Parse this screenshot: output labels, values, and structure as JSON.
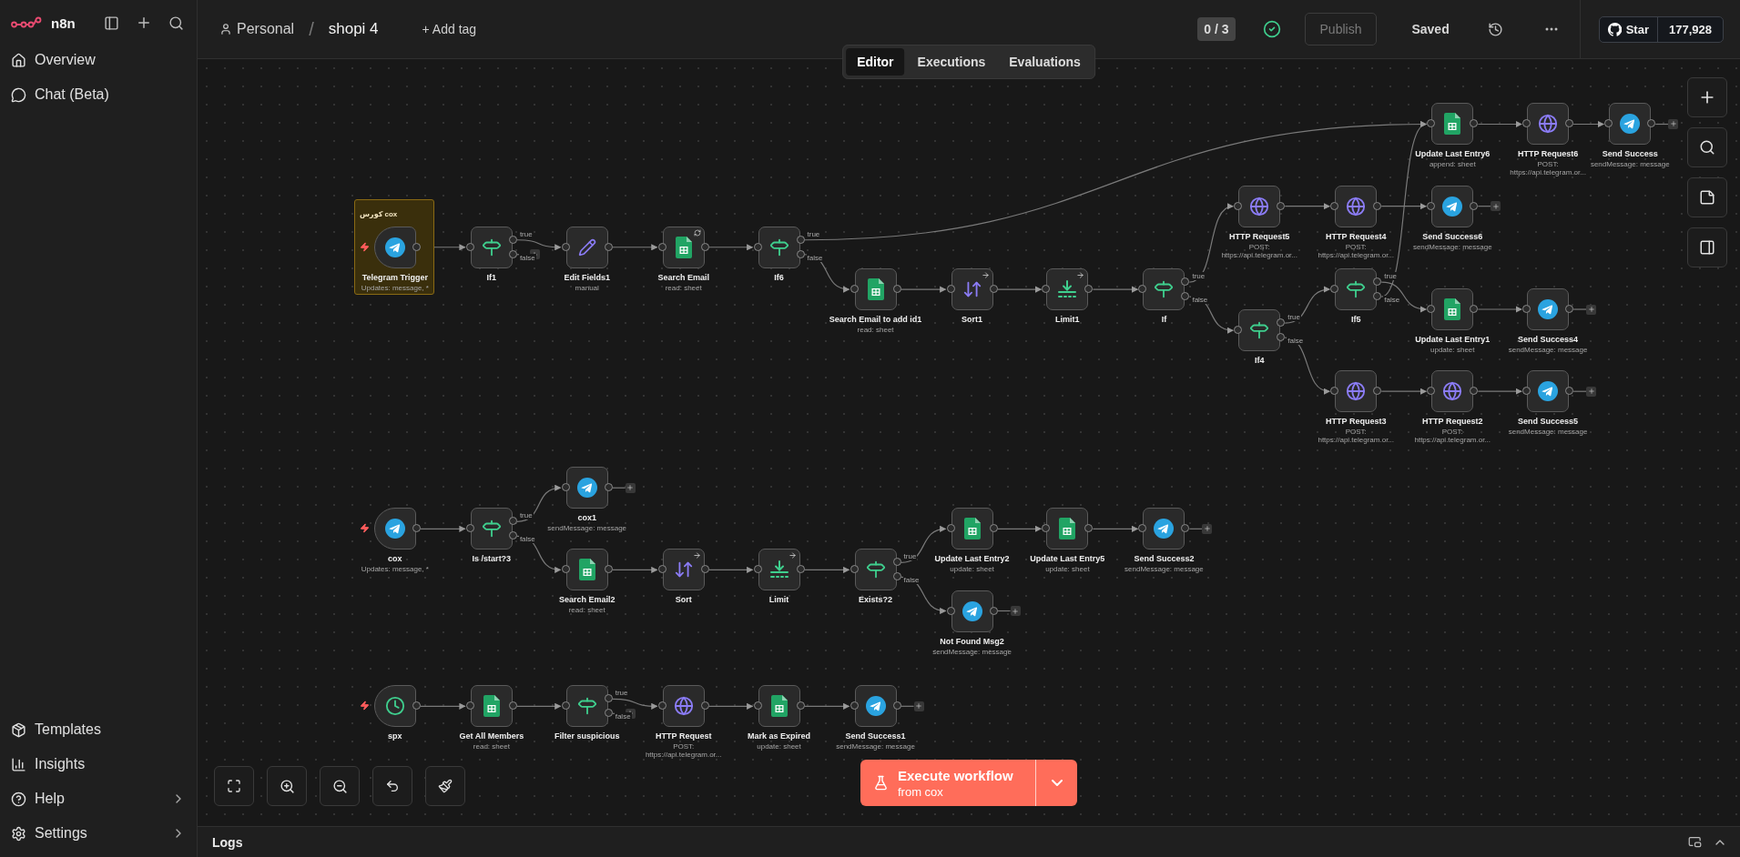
{
  "sidebar": {
    "brand": "n8n",
    "top_items": [
      {
        "label": "Overview",
        "has_submenu": false
      },
      {
        "label": "Chat (Beta)",
        "has_submenu": false
      }
    ],
    "bottom_items": [
      {
        "label": "Templates",
        "has_submenu": false
      },
      {
        "label": "Insights",
        "has_submenu": false
      },
      {
        "label": "Help",
        "has_submenu": true
      },
      {
        "label": "Settings",
        "has_submenu": true
      }
    ]
  },
  "header": {
    "project": "Personal",
    "separator": "/",
    "workflow": "shopi 4",
    "add_tag": "+ Add tag",
    "counter": "0 / 3",
    "publish": {
      "label": "Publish",
      "disabled": true
    },
    "save_status": "Saved",
    "github": {
      "label": "Star",
      "count": "177,928"
    }
  },
  "tabs": [
    {
      "label": "Editor",
      "selected": true
    },
    {
      "label": "Executions",
      "selected": false
    },
    {
      "label": "Evaluations",
      "selected": false
    }
  ],
  "canvas": {
    "sticky_note": {
      "text": "کورس cox"
    },
    "nodes": [
      {
        "name": "Telegram Trigger",
        "subtitle": "Updates: message, *",
        "kind": "telegram_trigger"
      },
      {
        "name": "If1",
        "kind": "if",
        "outputs": [
          "true",
          "false"
        ]
      },
      {
        "name": "Edit Fields1",
        "subtitle": "manual",
        "kind": "set"
      },
      {
        "name": "Search Email",
        "subtitle": "read: sheet",
        "kind": "sheets",
        "badge": {
          "kind": "sync"
        }
      },
      {
        "name": "If6",
        "kind": "if",
        "outputs": [
          "true",
          "false"
        ]
      },
      {
        "name": "Search Email to add id1",
        "subtitle": "read: sheet",
        "kind": "sheets"
      },
      {
        "name": "Sort1",
        "kind": "sort",
        "badge": {
          "kind": "arrow"
        }
      },
      {
        "name": "Limit1",
        "kind": "limit",
        "badge": {
          "kind": "arrow"
        }
      },
      {
        "name": "If",
        "kind": "if",
        "outputs": [
          "true",
          "false"
        ]
      },
      {
        "name": "Update Last Entry6",
        "subtitle": "append: sheet",
        "kind": "sheets"
      },
      {
        "name": "HTTP Request6",
        "subtitle": "POST: https://api.telegram.or...",
        "kind": "http"
      },
      {
        "name": "Send Success",
        "subtitle": "sendMessage: message",
        "kind": "telegram"
      },
      {
        "name": "HTTP Request5",
        "subtitle": "POST: https://api.telegram.or...",
        "kind": "http"
      },
      {
        "name": "HTTP Request4",
        "subtitle": "POST: https://api.telegram.or...",
        "kind": "http"
      },
      {
        "name": "Send Success6",
        "subtitle": "sendMessage: message",
        "kind": "telegram"
      },
      {
        "name": "If4",
        "kind": "if",
        "outputs": [
          "true",
          "false"
        ]
      },
      {
        "name": "If5",
        "kind": "if",
        "outputs": [
          "true",
          "false"
        ]
      },
      {
        "name": "Update Last Entry1",
        "subtitle": "update: sheet",
        "kind": "sheets"
      },
      {
        "name": "Send Success4",
        "subtitle": "sendMessage: message",
        "kind": "telegram"
      },
      {
        "name": "HTTP Request3",
        "subtitle": "POST: https://api.telegram.or...",
        "kind": "http"
      },
      {
        "name": "HTTP Request2",
        "subtitle": "POST: https://api.telegram.or...",
        "kind": "http"
      },
      {
        "name": "Send Success5",
        "subtitle": "sendMessage: message",
        "kind": "telegram"
      },
      {
        "name": "cox",
        "subtitle": "Updates: message, *",
        "kind": "telegram_trigger"
      },
      {
        "name": "Is /start?3",
        "kind": "if",
        "outputs": [
          "true",
          "false"
        ]
      },
      {
        "name": "cox1",
        "subtitle": "sendMessage: message",
        "kind": "telegram"
      },
      {
        "name": "Search Email2",
        "subtitle": "read: sheet",
        "kind": "sheets"
      },
      {
        "name": "Sort",
        "kind": "sort",
        "badge": {
          "kind": "arrow"
        }
      },
      {
        "name": "Limit",
        "kind": "limit",
        "badge": {
          "kind": "arrow"
        }
      },
      {
        "name": "Exists?2",
        "kind": "if",
        "outputs": [
          "true",
          "false"
        ]
      },
      {
        "name": "Update Last Entry2",
        "subtitle": "update: sheet",
        "kind": "sheets"
      },
      {
        "name": "Update Last Entry5",
        "subtitle": "update: sheet",
        "kind": "sheets"
      },
      {
        "name": "Send Success2",
        "subtitle": "sendMessage: message",
        "kind": "telegram"
      },
      {
        "name": "Not Found Msg2",
        "subtitle": "sendMessage: message",
        "kind": "telegram"
      },
      {
        "name": "spx",
        "kind": "schedule_trigger"
      },
      {
        "name": "Get All Members",
        "subtitle": "read: sheet",
        "kind": "sheets"
      },
      {
        "name": "Filter suspicious",
        "kind": "if",
        "outputs": [
          "true",
          "false"
        ]
      },
      {
        "name": "HTTP Request",
        "subtitle": "POST: https://api.telegram.or...",
        "kind": "http"
      },
      {
        "name": "Mark as Expired",
        "subtitle": "update: sheet",
        "kind": "sheets"
      },
      {
        "name": "Send Success1",
        "subtitle": "sendMessage: message",
        "kind": "telegram"
      }
    ]
  },
  "execute": {
    "label": "Execute workflow",
    "sub": "from cox"
  },
  "logs": {
    "title": "Logs"
  }
}
